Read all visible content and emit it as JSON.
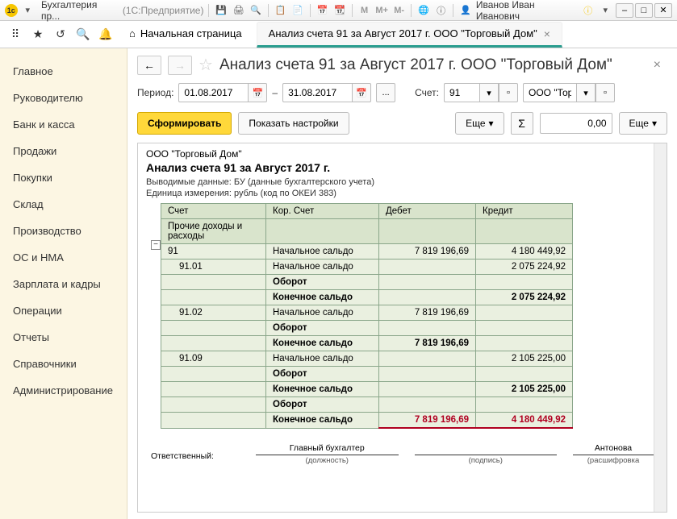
{
  "titlebar": {
    "app_name": "Бухгалтерия пр...",
    "platform": "(1С:Предприятие)",
    "user": "Иванов Иван Иванович"
  },
  "tabs": {
    "home": "Начальная страница",
    "active": "Анализ счета 91 за Август 2017 г. ООО \"Торговый Дом\""
  },
  "sidebar": {
    "items": [
      "Главное",
      "Руководителю",
      "Банк и касса",
      "Продажи",
      "Покупки",
      "Склад",
      "Производство",
      "ОС и НМА",
      "Зарплата и кадры",
      "Операции",
      "Отчеты",
      "Справочники",
      "Администрирование"
    ]
  },
  "page": {
    "title": "Анализ счета 91 за Август 2017 г. ООО \"Торговый Дом\""
  },
  "filters": {
    "period_label": "Период:",
    "date_from": "01.08.2017",
    "dash": "–",
    "date_to": "31.08.2017",
    "ellipsis": "...",
    "account_label": "Счет:",
    "account": "91",
    "org": "ООО \"Торг"
  },
  "actions": {
    "generate": "Сформировать",
    "show_settings": "Показать настройки",
    "more1": "Еще",
    "sum": "Σ",
    "sum_value": "0,00",
    "more2": "Еще"
  },
  "report": {
    "org": "ООО \"Торговый Дом\"",
    "title": "Анализ счета 91 за Август 2017 г.",
    "meta1": "Выводимые данные:   БУ (данные бухгалтерского учета)",
    "meta2": "Единица измерения:   рубль (код по ОКЕИ 383)",
    "headers": {
      "acct": "Счет",
      "corr": "Кор. Счет",
      "debit": "Дебет",
      "credit": "Кредит"
    },
    "chart_data": {
      "type": "table",
      "columns": [
        "Счет",
        "Кор. Счет",
        "Дебет",
        "Кредит"
      ],
      "rows": [
        {
          "acct": "Прочие доходы и расходы",
          "corr": "",
          "debit": "",
          "credit": "",
          "header": true
        },
        {
          "acct": "91",
          "corr": "Начальное сальдо",
          "debit": "7 819 196,69",
          "credit": "4 180 449,92",
          "level": 0
        },
        {
          "acct": "91.01",
          "corr": "Начальное сальдо",
          "debit": "",
          "credit": "2 075 224,92",
          "level": 1
        },
        {
          "acct": "",
          "corr": "Оборот",
          "debit": "",
          "credit": "",
          "level": 1,
          "bold": true
        },
        {
          "acct": "",
          "corr": "Конечное сальдо",
          "debit": "",
          "credit": "2 075 224,92",
          "level": 1,
          "bold": true
        },
        {
          "acct": "91.02",
          "corr": "Начальное сальдо",
          "debit": "7 819 196,69",
          "credit": "",
          "level": 1
        },
        {
          "acct": "",
          "corr": "Оборот",
          "debit": "",
          "credit": "",
          "level": 1,
          "bold": true
        },
        {
          "acct": "",
          "corr": "Конечное сальдо",
          "debit": "7 819 196,69",
          "credit": "",
          "level": 1,
          "bold": true
        },
        {
          "acct": "91.09",
          "corr": "Начальное сальдо",
          "debit": "",
          "credit": "2 105 225,00",
          "level": 1
        },
        {
          "acct": "",
          "corr": "Оборот",
          "debit": "",
          "credit": "",
          "level": 1,
          "bold": true
        },
        {
          "acct": "",
          "corr": "Конечное сальдо",
          "debit": "",
          "credit": "2 105 225,00",
          "level": 1,
          "bold": true
        },
        {
          "acct": "",
          "corr": "Оборот",
          "debit": "",
          "credit": "",
          "level": 0,
          "bold": true
        },
        {
          "acct": "",
          "corr": "Конечное сальдо",
          "debit": "7 819 196,69",
          "credit": "4 180 449,92",
          "level": 0,
          "bold": true,
          "final": true
        }
      ]
    },
    "sig": {
      "resp": "Ответственный:",
      "chief": "Главный бухгалтер",
      "post": "(должность)",
      "sign": "(подпись)",
      "name": "Антонова",
      "decode": "(расшифровка"
    }
  }
}
